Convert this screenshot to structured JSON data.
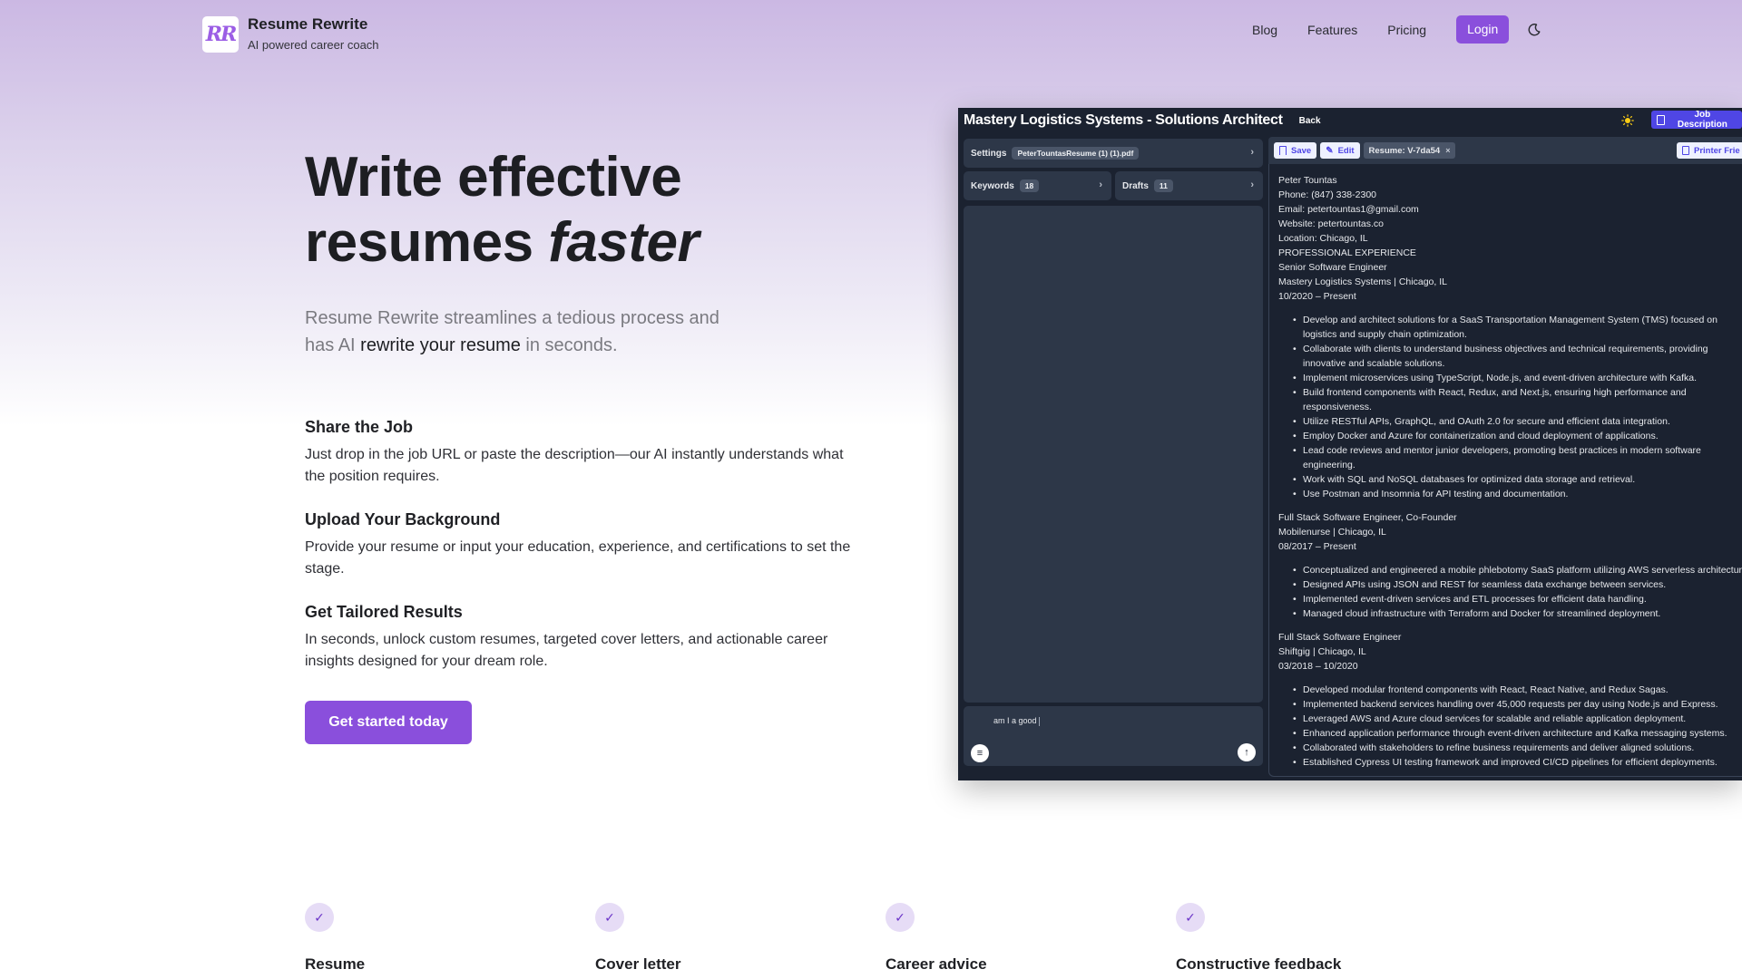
{
  "header": {
    "logo_text": "RR",
    "brand_name": "Resume Rewrite",
    "brand_tagline": "AI powered career coach",
    "nav": [
      {
        "label": "Blog"
      },
      {
        "label": "Features"
      },
      {
        "label": "Pricing"
      }
    ],
    "login_label": "Login",
    "theme_toggle_icon": "moon-icon"
  },
  "hero": {
    "title_line1": "Write effective",
    "title_line2": "resumes ",
    "title_emphasis": "faster",
    "subtitle_part1": "Resume Rewrite streamlines a tedious process and has AI ",
    "subtitle_strong": "rewrite your resume",
    "subtitle_part2": " in seconds."
  },
  "steps": [
    {
      "title": "Share the Job",
      "text": "Just drop in the job URL or paste the description—our AI instantly understands what the position requires."
    },
    {
      "title": "Upload Your Background",
      "text": "Provide your resume or input your education, experience, and certifications to set the stage."
    },
    {
      "title": "Get Tailored Results",
      "text": "In seconds, unlock custom resumes, targeted cover letters, and actionable career insights designed for your dream role."
    }
  ],
  "cta_label": "Get started today",
  "features": [
    {
      "label": "Resume",
      "icon": "check-icon"
    },
    {
      "label": "Cover letter",
      "icon": "check-icon"
    },
    {
      "label": "Career advice",
      "icon": "check-icon"
    },
    {
      "label": "Constructive feedback",
      "icon": "check-icon"
    }
  ],
  "app": {
    "title": "Mastery Logistics Systems - Solutions Architect",
    "back_label": "Back",
    "job_description_label": "Job Description",
    "settings_label": "Settings",
    "settings_file": "PeterTountasResume (1) (1).pdf",
    "keywords_label": "Keywords",
    "keywords_count": "18",
    "drafts_label": "Drafts",
    "drafts_count": "11",
    "chat_input_value": "am I a good",
    "toolbar": {
      "save_label": "Save",
      "edit_label": "Edit",
      "resume_tag": "Resume: V-7da54",
      "printer_label": "Printer Frie"
    },
    "resume": {
      "header_lines": [
        "Peter Tountas",
        "Phone: (847) 338-2300",
        "Email: petertountas1@gmail.com",
        "Website: petertountas.co",
        "Location: Chicago, IL",
        "PROFESSIONAL EXPERIENCE",
        "Senior Software Engineer",
        "Mastery Logistics Systems | Chicago, IL",
        "10/2020 – Present"
      ],
      "job1_bullets": [
        "Develop and architect solutions for a SaaS Transportation Management System (TMS) focused on logistics and supply chain optimization.",
        "Collaborate with clients to understand business objectives and technical requirements, providing innovative and scalable solutions.",
        "Implement microservices using TypeScript, Node.js, and event-driven architecture with Kafka.",
        "Build frontend components with React, Redux, and Next.js, ensuring high performance and responsiveness.",
        "Utilize RESTful APIs, GraphQL, and OAuth 2.0 for secure and efficient data integration.",
        "Employ Docker and Azure for containerization and cloud deployment of applications.",
        "Lead code reviews and mentor junior developers, promoting best practices in modern software engineering.",
        "Work with SQL and NoSQL databases for optimized data storage and retrieval.",
        "Use Postman and Insomnia for API testing and documentation."
      ],
      "job2_lines": [
        "Full Stack Software Engineer, Co-Founder",
        "Mobilenurse | Chicago, IL",
        "08/2017 – Present"
      ],
      "job2_bullets": [
        "Conceptualized and engineered a mobile phlebotomy SaaS platform utilizing AWS serverless architecture.",
        "Designed APIs using JSON and REST for seamless data exchange between services.",
        "Implemented event-driven services and ETL processes for efficient data handling.",
        "Managed cloud infrastructure with Terraform and Docker for streamlined deployment."
      ],
      "job3_lines": [
        "Full Stack Software Engineer",
        "Shiftgig | Chicago, IL",
        "03/2018 – 10/2020"
      ],
      "job3_bullets": [
        "Developed modular frontend components with React, React Native, and Redux Sagas.",
        "Implemented backend services handling over 45,000 requests per day using Node.js and Express.",
        "Leveraged AWS and Azure cloud services for scalable and reliable application deployment.",
        "Enhanced application performance through event-driven architecture and Kafka messaging systems.",
        "Collaborated with stakeholders to refine business requirements and deliver aligned solutions.",
        "Established Cypress UI testing framework and improved CI/CD pipelines for efficient deployments."
      ]
    }
  }
}
